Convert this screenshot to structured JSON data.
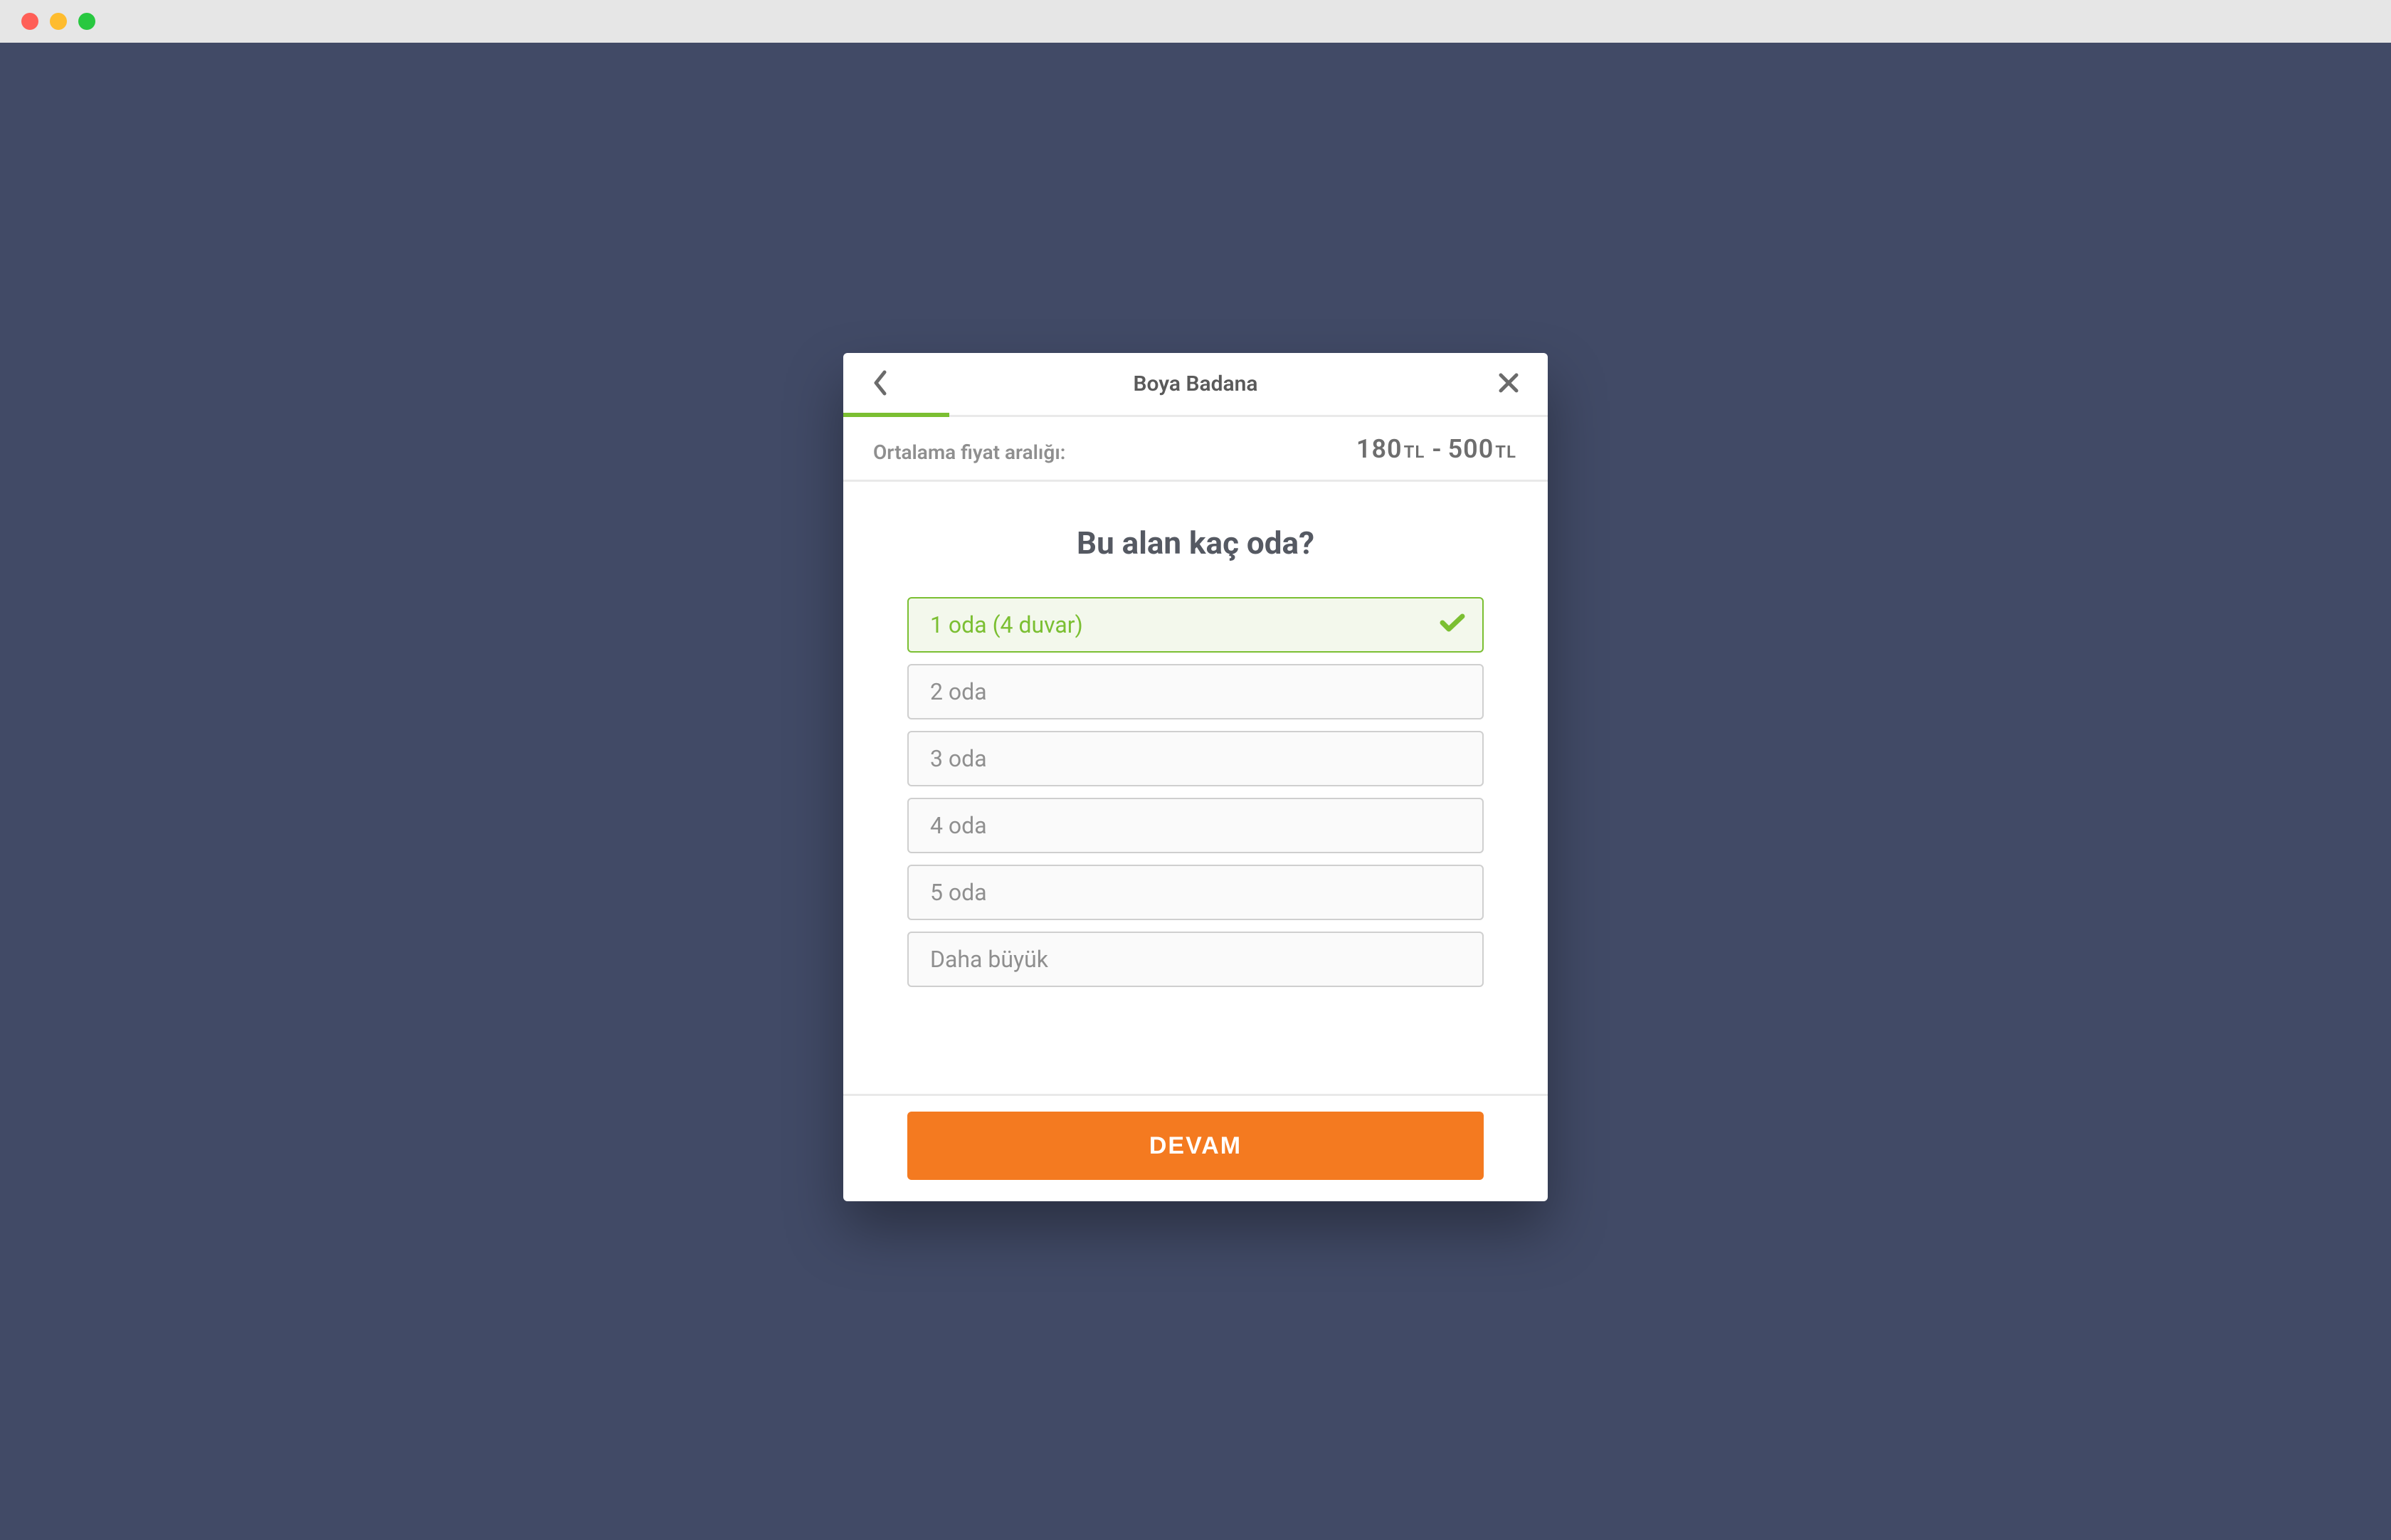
{
  "window": {
    "traffic_lights": [
      "red",
      "orange",
      "green"
    ]
  },
  "modal": {
    "title": "Boya Badana",
    "progress_percent": 15,
    "price": {
      "label": "Ortalama fiyat aralığı:",
      "min": "180",
      "max": "500",
      "currency": "TL",
      "separator": "-"
    },
    "question": "Bu alan kaç oda?",
    "selected_index": 0,
    "options": [
      {
        "label": "1 oda (4 duvar)"
      },
      {
        "label": "2 oda"
      },
      {
        "label": "3 oda"
      },
      {
        "label": "4 oda"
      },
      {
        "label": "5 oda"
      },
      {
        "label": "Daha büyük"
      }
    ],
    "continue_label": "DEVAM"
  },
  "colors": {
    "background": "#414a66",
    "accent_green": "#7bbf32",
    "accent_orange": "#f47a20"
  }
}
